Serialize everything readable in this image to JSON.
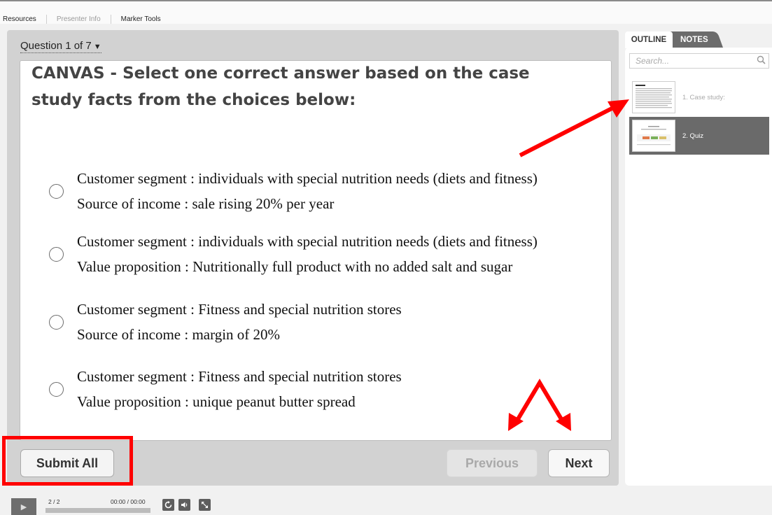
{
  "top_nav": {
    "resources": "Resources",
    "presenter_info": "Presenter Info",
    "marker_tools": "Marker Tools"
  },
  "quiz": {
    "question_selector": "Question 1 of 7",
    "question_text": "CANVAS - Select one correct answer based on the case study facts from the choices below:",
    "choices": [
      {
        "line1": "Customer segment : individuals with special nutrition needs (diets and fitness)",
        "line2": "Source of income : sale rising 20% per year"
      },
      {
        "line1": "Customer segment : individuals with special nutrition needs (diets and fitness)",
        "line2": "Value proposition : Nutritionally full product with no added salt and sugar"
      },
      {
        "line1": "Customer segment : Fitness and special nutrition stores",
        "line2": "Source of income : margin of 20%"
      },
      {
        "line1": "Customer segment : Fitness and special nutrition stores",
        "line2": "Value proposition : unique peanut butter spread"
      }
    ],
    "buttons": {
      "submit_all": "Submit All",
      "previous": "Previous",
      "next": "Next"
    }
  },
  "sidebar": {
    "tabs": {
      "outline": "OUTLINE",
      "notes": "NOTES"
    },
    "search_placeholder": "Search...",
    "slides": [
      {
        "label": "1. Case study:"
      },
      {
        "label": "2. Quiz",
        "selected": true
      }
    ]
  },
  "player": {
    "slide_count": "2 / 2",
    "time": "00:00 / 00:00"
  },
  "colors": {
    "annotation": "#ff0000",
    "selected_slide": "#6a6a6a"
  }
}
